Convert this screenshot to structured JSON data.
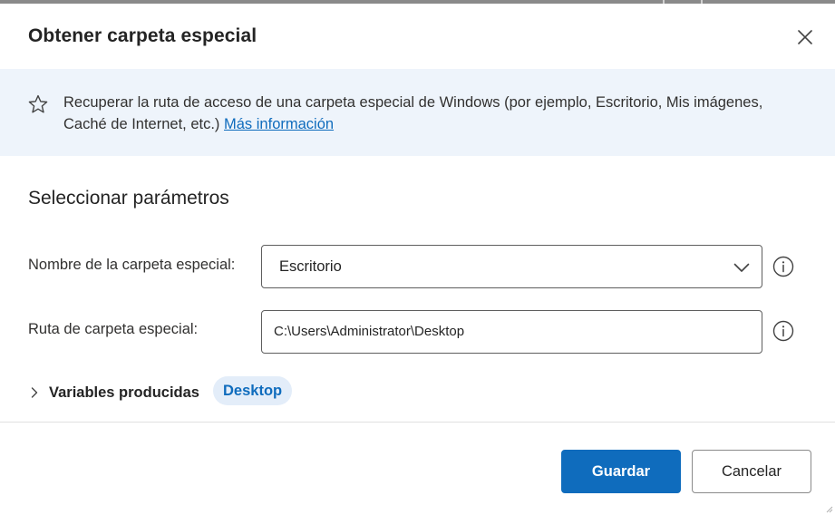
{
  "dialog": {
    "title": "Obtener carpeta especial"
  },
  "banner": {
    "description": "Recuperar la ruta de acceso de una carpeta especial de Windows (por ejemplo, Escritorio, Mis imágenes, Caché de Internet, etc.) ",
    "link_label": "Más información",
    "icon": "star-icon"
  },
  "parameters": {
    "section_title": "Seleccionar parámetros",
    "special_folder_name": {
      "label": "Nombre de la carpeta especial:",
      "value": "Escritorio"
    },
    "special_folder_path": {
      "label": "Ruta de carpeta especial:",
      "value": "C:\\Users\\Administrator\\Desktop"
    }
  },
  "produced_variables": {
    "label": "Variables producidas",
    "variables": [
      "Desktop"
    ]
  },
  "footer": {
    "save_label": "Guardar",
    "cancel_label": "Cancelar"
  },
  "colors": {
    "accent": "#0f6cbd",
    "banner_bg": "#eef4fb",
    "chip_bg": "#e3edf9"
  }
}
